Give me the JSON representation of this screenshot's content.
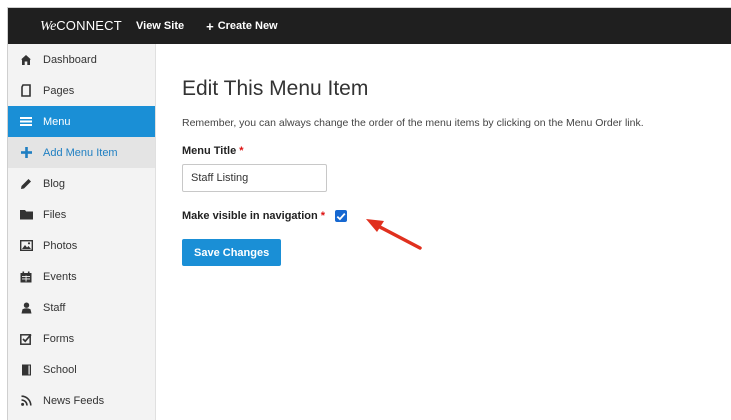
{
  "topbar": {
    "logo_we": "We",
    "logo_connect": "CONNECT",
    "view_site": "View Site",
    "create_new_plus": "+",
    "create_new": "Create New"
  },
  "sidebar": {
    "items": [
      {
        "label": "Dashboard",
        "icon": "home-icon"
      },
      {
        "label": "Pages",
        "icon": "page-icon"
      },
      {
        "label": "Menu",
        "icon": "menu-icon",
        "active": true
      },
      {
        "label": "Add Menu Item",
        "icon": "plus-icon",
        "sub": true
      },
      {
        "label": "Blog",
        "icon": "pencil-icon"
      },
      {
        "label": "Files",
        "icon": "folder-icon"
      },
      {
        "label": "Photos",
        "icon": "photo-icon"
      },
      {
        "label": "Events",
        "icon": "calendar-icon"
      },
      {
        "label": "Staff",
        "icon": "user-icon"
      },
      {
        "label": "Forms",
        "icon": "checkbox-form-icon"
      },
      {
        "label": "School",
        "icon": "book-icon"
      },
      {
        "label": "News Feeds",
        "icon": "rss-icon"
      }
    ]
  },
  "main": {
    "title": "Edit This Menu Item",
    "intro": "Remember, you can always change the order of the menu items by clicking on the Menu Order link.",
    "menu_title_label": "Menu Title",
    "required_mark": "*",
    "menu_title_value": "Staff Listing",
    "visible_label": "Make visible in navigation",
    "visible_checked": true,
    "save_label": "Save Changes"
  },
  "colors": {
    "topbar": "#1f1f1f",
    "accent": "#1a8fd6",
    "required": "#dd1111",
    "arrow": "#e0301e"
  }
}
